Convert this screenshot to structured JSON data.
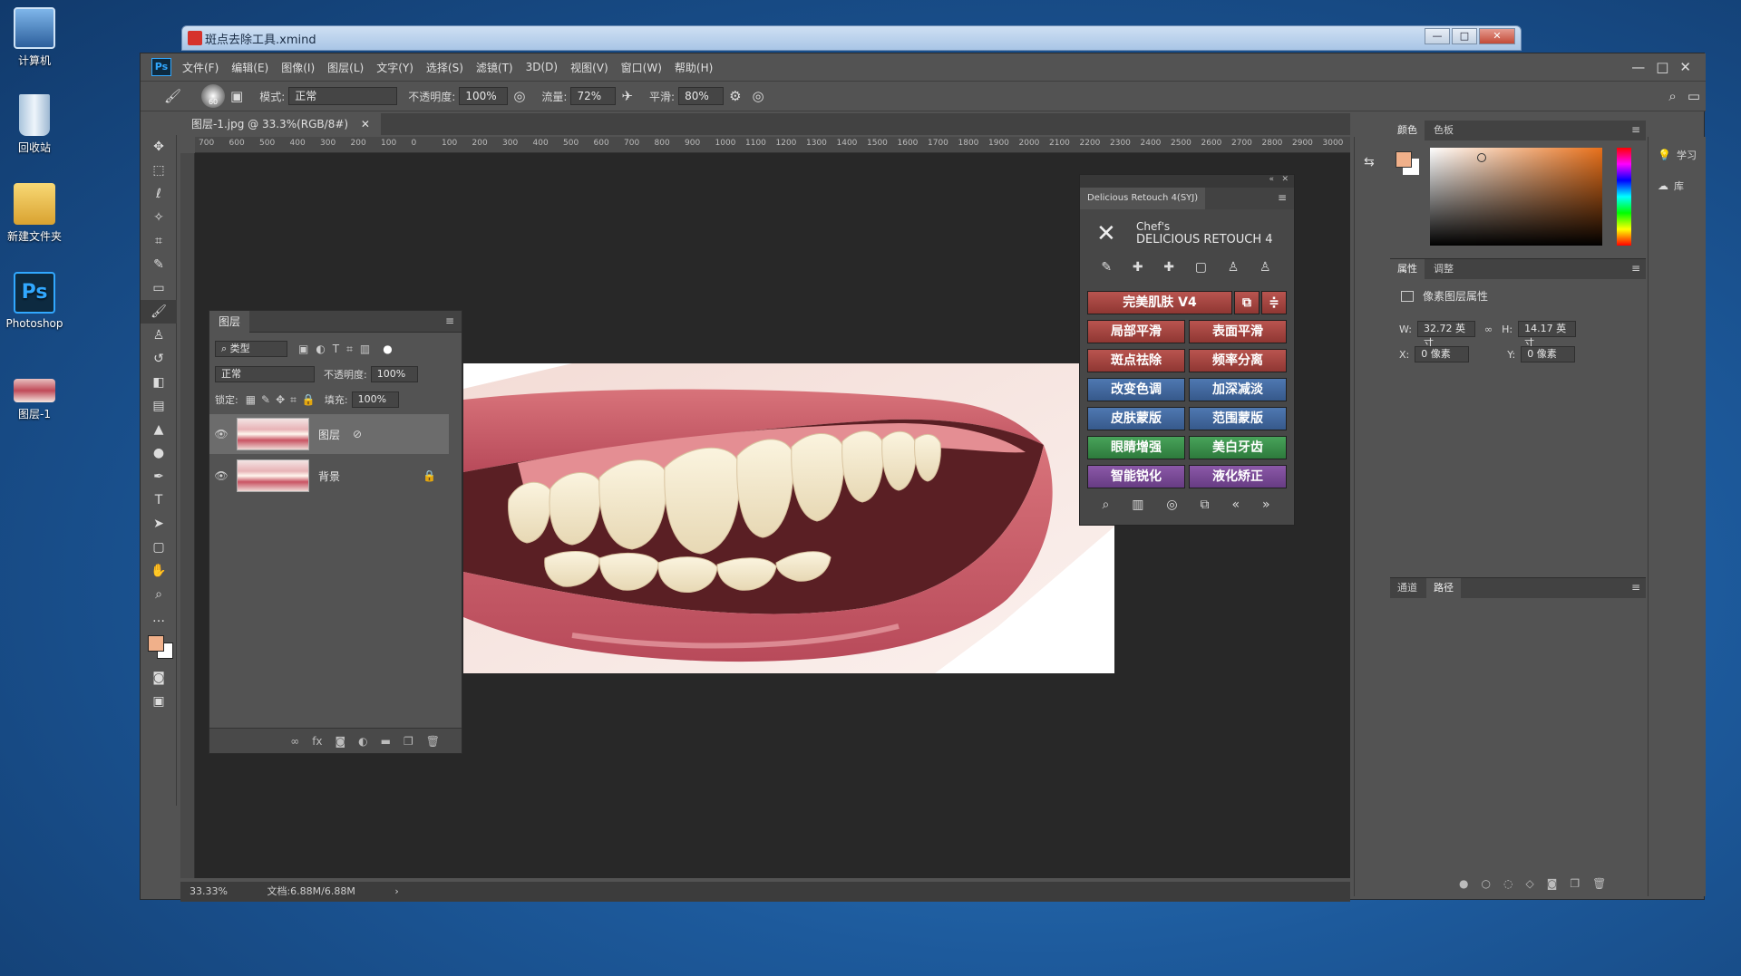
{
  "desktop": {
    "icons": [
      {
        "label": "计算机",
        "icon": "computer-icon"
      },
      {
        "label": "回收站",
        "icon": "recycle-bin-icon"
      },
      {
        "label": "新建文件夹",
        "icon": "folder-icon"
      },
      {
        "label": "Photoshop",
        "icon": "photoshop-icon"
      },
      {
        "label": "图层-1",
        "icon": "image-file-icon"
      }
    ]
  },
  "xmind": {
    "title": "斑点去除工具.xmind"
  },
  "menubar": [
    "文件(F)",
    "编辑(E)",
    "图像(I)",
    "图层(L)",
    "文字(Y)",
    "选择(S)",
    "滤镜(T)",
    "3D(D)",
    "视图(V)",
    "窗口(W)",
    "帮助(H)"
  ],
  "options": {
    "brush_size": "60",
    "mode_label": "模式:",
    "mode_value": "正常",
    "opacity_label": "不透明度:",
    "opacity_value": "100%",
    "flow_label": "流量:",
    "flow_value": "72%",
    "smooth_label": "平滑:",
    "smooth_value": "80%"
  },
  "document": {
    "tab_label": "图层-1.jpg @ 33.3%(RGB/8#)"
  },
  "ruler": [
    "700",
    "600",
    "500",
    "400",
    "300",
    "200",
    "100",
    "0",
    "100",
    "200",
    "300",
    "400",
    "500",
    "600",
    "700",
    "800",
    "900",
    "1000",
    "1100",
    "1200",
    "1300",
    "1400",
    "1500",
    "1600",
    "1700",
    "1800",
    "1900",
    "2000",
    "2100",
    "2200",
    "2300",
    "2400",
    "2500",
    "2600",
    "2700",
    "2800",
    "2900",
    "3000"
  ],
  "status": {
    "zoom": "33.33%",
    "doc": "文档:6.88M/6.88M"
  },
  "layers": {
    "tab": "图层",
    "filter_label": "类型",
    "blend": "正常",
    "opacity_label": "不透明度:",
    "opacity": "100%",
    "lock_label": "锁定:",
    "fill_label": "填充:",
    "fill": "100%",
    "items": [
      {
        "name": "图层"
      },
      {
        "name": "背景"
      }
    ]
  },
  "retouch": {
    "title": "Delicious Retouch 4(SYJ)",
    "brand_line1": "Chef's",
    "brand_line2": "DELICIOUS RETOUCH 4",
    "buttons": {
      "perfect_skin": "完美肌肤 V4",
      "local_smooth": "局部平滑",
      "surface_smooth": "表面平滑",
      "spot_remove": "斑点祛除",
      "freq_sep": "频率分离",
      "change_tone": "改变色调",
      "dodge_burn": "加深减淡",
      "skin_mask": "皮肤蒙版",
      "range_mask": "范围蒙版",
      "eye_enhance": "眼睛增强",
      "whiten_teeth": "美白牙齿",
      "smart_sharpen": "智能锐化",
      "liquify": "液化矫正"
    }
  },
  "right_panels": {
    "color_tabs": [
      "颜色",
      "色板"
    ],
    "prop_tabs": [
      "属性",
      "调整"
    ],
    "prop_title": "像素图层属性",
    "w_label": "W:",
    "w_value": "32.72 英寸",
    "h_label": "H:",
    "h_value": "14.17 英寸",
    "x_label": "X:",
    "x_value": "0 像素",
    "y_label": "Y:",
    "y_value": "0 像素",
    "paths_tabs": [
      "通道",
      "路径"
    ],
    "learn": "学习",
    "library": "库"
  },
  "colors": {
    "fg": "#f0b08a",
    "bg": "#ffffff"
  }
}
